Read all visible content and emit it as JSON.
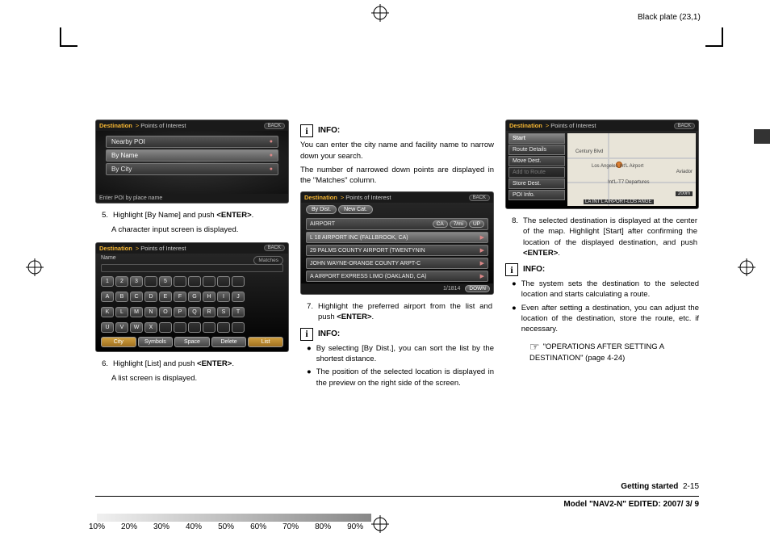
{
  "plate_label": "Black plate (23,1)",
  "screens": {
    "poi_menu": {
      "breadcrumb_main": "Destination",
      "breadcrumb_sub": "Points of Interest",
      "back": "BACK",
      "items": [
        "Nearby POI",
        "By Name",
        "By City"
      ],
      "footer": "Enter POI by place name"
    },
    "keyboard": {
      "breadcrumb_main": "Destination",
      "breadcrumb_sub": "Points of Interest",
      "back": "BACK",
      "name_label": "Name",
      "matches_label": "Matches",
      "row1": [
        "1",
        "2",
        "3",
        "",
        "5",
        "",
        "",
        "",
        "",
        ""
      ],
      "row2": [
        "A",
        "B",
        "C",
        "D",
        "E",
        "F",
        "G",
        "H",
        "I",
        "J"
      ],
      "row3": [
        "K",
        "L",
        "M",
        "N",
        "O",
        "P",
        "Q",
        "R",
        "S",
        "T"
      ],
      "row4": [
        "U",
        "V",
        "W",
        "X",
        "",
        "",
        "",
        "",
        "",
        ""
      ],
      "btns": {
        "city": "City",
        "symbols": "Symbols",
        "space": "Space",
        "delete": "Delete",
        "list": "List"
      }
    },
    "list": {
      "breadcrumb_main": "Destination",
      "breadcrumb_sub": "Points of Interest",
      "back": "BACK",
      "by_dist": "By Dist.",
      "new_cat": "New Cat.",
      "state": "CA",
      "distance": "7/mi",
      "up": "UP",
      "down": "DOWN",
      "counter": "1/1814",
      "rows": [
        "AIRPORT",
        "L 18 AIRPORT INC (FALLBROOK, CA)",
        "29 PALMS COUNTY AIRPORT (TWENTYNIN",
        "JOHN WAYNE-ORANGE COUNTY ARPT-C",
        "A AIRPORT EXPRESS LIMO (OAKLAND, CA)"
      ]
    },
    "map_menu": {
      "breadcrumb_main": "Destination",
      "breadcrumb_sub": "Points of Interest",
      "back": "BACK",
      "items": [
        "Start",
        "Route Details",
        "Move Dest.",
        "Add to Route",
        "Store Dest.",
        "POI Info."
      ],
      "map_labels": {
        "a": "Los Angeles Int'L Airport",
        "b": "Int'L-T7 Departures",
        "c": "LA INT'L AIRPORT-LOS ANGE",
        "d": "Aviador",
        "e": "Century Blvd",
        "scale": "200m"
      }
    }
  },
  "col1": {
    "step5_a": "Highlight [By Name] and push ",
    "step5_b": "<ENTER>",
    "step5_c": ".",
    "step5_2": "A character input screen is displayed.",
    "step6_a": "Highlight [List] and push ",
    "step6_b": "<ENTER>",
    "step6_c": ".",
    "step6_2": "A list screen is displayed."
  },
  "col2": {
    "info1_label": "INFO:",
    "info1_p1": "You can enter the city name and facility name to narrow down your search.",
    "info1_p2": "The number of narrowed down points are displayed in the \"Matches\" column.",
    "step7_a": "Highlight the preferred airport from the list and push ",
    "step7_b": "<ENTER>",
    "step7_c": ".",
    "info2_label": "INFO:",
    "bul1": "By selecting [By Dist.], you can sort the list by the shortest distance.",
    "bul2": "The position of the selected location is displayed in the preview on the right side of the screen."
  },
  "col3": {
    "step8_a": "The selected destination is displayed at the center of the map. Highlight [Start] after confirming the location of the displayed destination, and push ",
    "step8_b": "<ENTER>",
    "step8_c": ".",
    "info_label": "INFO:",
    "bul1": "The system sets the destination to the selected location and starts calculating a route.",
    "bul2": "Even after setting a destination, you can adjust the location of the destination, store the route, etc. if necessary.",
    "ref": "\"OPERATIONS AFTER SETTING A DESTINATION\" (page 4-24)"
  },
  "footer": {
    "section": "Getting started",
    "page": "2-15",
    "model_a": "Model \"",
    "model_b": "NAV2-N",
    "model_c": "\" EDITED: 2007/ 3/ 9"
  },
  "percents": [
    "10%",
    "20%",
    "30%",
    "40%",
    "50%",
    "60%",
    "70%",
    "80%",
    "90%"
  ]
}
